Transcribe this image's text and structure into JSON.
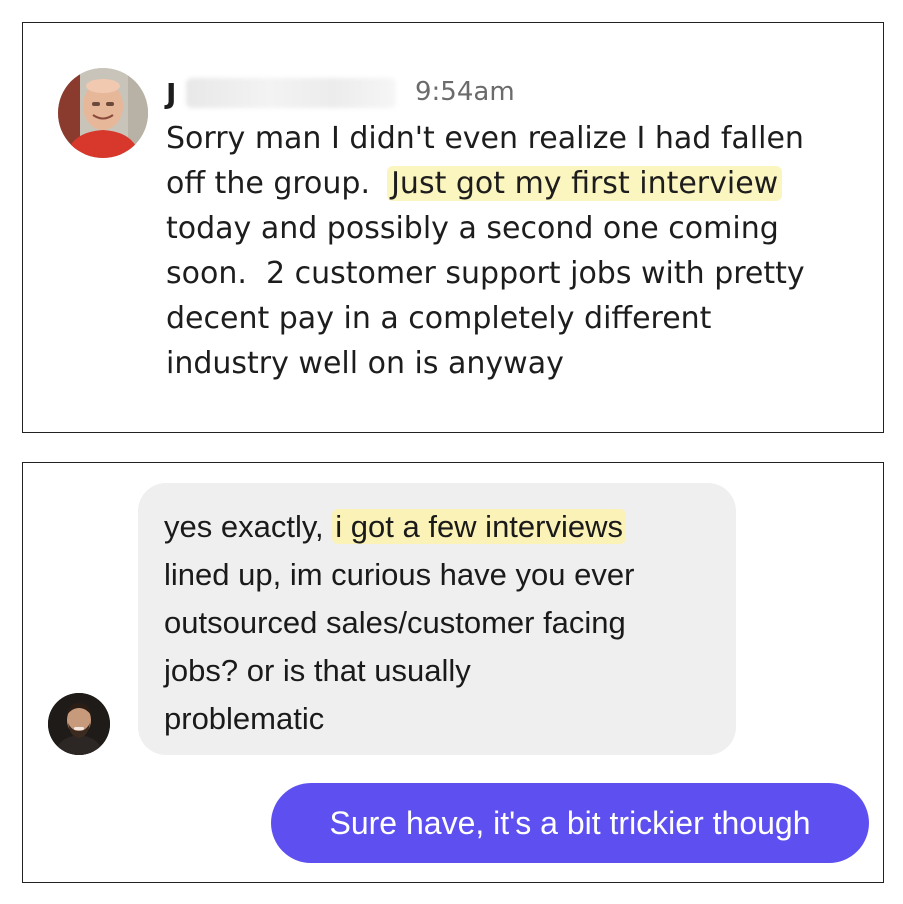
{
  "panel1": {
    "sender_initial": "J",
    "timestamp": "9:54am",
    "lines": [
      "Sorry man I didn't even realize I had fallen",
      "off the group.  ",
      "today and possibly a second one coming",
      "soon.  2 customer support jobs with pretty",
      "decent pay in a completely different",
      "industry well on is anyway"
    ],
    "highlight": "Just got my first interview",
    "highlight_color": "#fbf5bf"
  },
  "panel2": {
    "incoming": {
      "line1_prefix": "yes exactly, ",
      "highlight": "i got a few interviews",
      "lines": [
        "lined up, im curious have you ever",
        "outsourced sales/customer facing",
        "jobs? or is that usually",
        "problematic"
      ],
      "bubble_color": "#efeff0"
    },
    "outgoing": {
      "text": "Sure have, it's a bit trickier though",
      "bubble_color": "#5d4ff0"
    }
  }
}
